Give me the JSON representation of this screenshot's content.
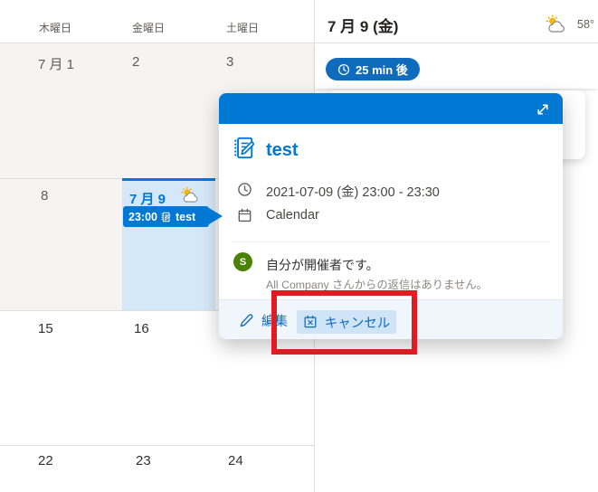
{
  "colors": {
    "accent": "#0078d4",
    "accent-dark": "#0f6cbd",
    "selected-cell": "#d5e8f9",
    "past-cell": "#f5f4f3",
    "grid-line": "#e1dfdd",
    "annotation-red": "#e11b22",
    "avatar-green": "#498205",
    "cancel-bg": "#cfe4f7",
    "footer-bg": "#f0f6fb",
    "text-dark": "#323130",
    "text-gray": "#605e5c",
    "text-subtle": "#8a8886"
  },
  "calendar": {
    "day_headers": [
      "木曜日",
      "金曜日",
      "土曜日"
    ],
    "dates": [
      "7 月 1",
      "2",
      "3",
      "8",
      "7 月 9",
      "15",
      "16",
      "22",
      "23",
      "24"
    ],
    "event_chip": {
      "time": "23:00",
      "title": "test"
    }
  },
  "panel": {
    "date_heading": "7 月 9 (金)",
    "temperature": "58°",
    "reminder": "25 min 後"
  },
  "popup": {
    "title": "test",
    "datetime": "2021-07-09 (金) 23:00 - 23:30",
    "calendar_name": "Calendar",
    "organizer_initial": "S",
    "organizer_text": "自分が開催者です。",
    "response_text": "All Company さんからの返信はありません。",
    "actions": {
      "edit": "編集",
      "cancel": "キャンセル"
    }
  }
}
